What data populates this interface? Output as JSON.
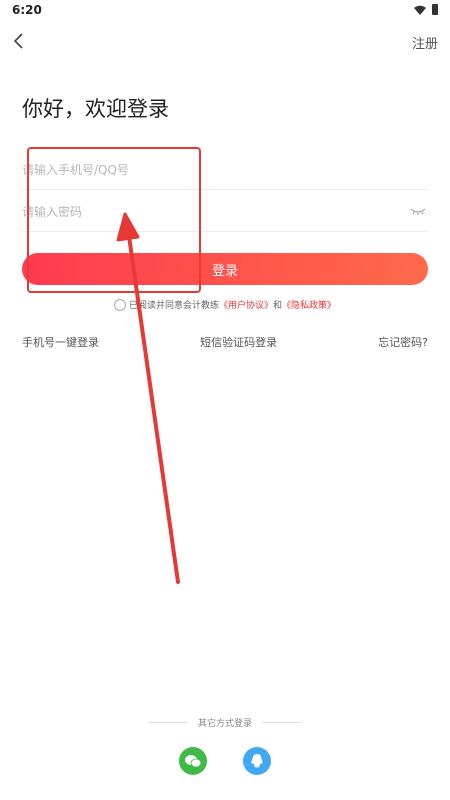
{
  "status_bar": {
    "time": "6:20"
  },
  "nav": {
    "register_label": "注册"
  },
  "title": "你好，欢迎登录",
  "form": {
    "phone_placeholder": "请输入手机号/QQ号",
    "password_placeholder": "请输入密码",
    "login_label": "登录"
  },
  "agreement": {
    "prefix": "已阅读并同意会计教练",
    "user_agreement": "《用户协议》",
    "conjunction": "和",
    "privacy_policy": "《隐私政策》"
  },
  "alt_logins": {
    "one_click": "手机号一键登录",
    "sms": "短信验证码登录",
    "forgot": "忘记密码?"
  },
  "other_logins": {
    "title": "其它方式登录"
  },
  "colors": {
    "accent": "#ff3b4e",
    "annotation": "#e53935",
    "wechat": "#3fba47",
    "qq": "#41a8f2"
  }
}
